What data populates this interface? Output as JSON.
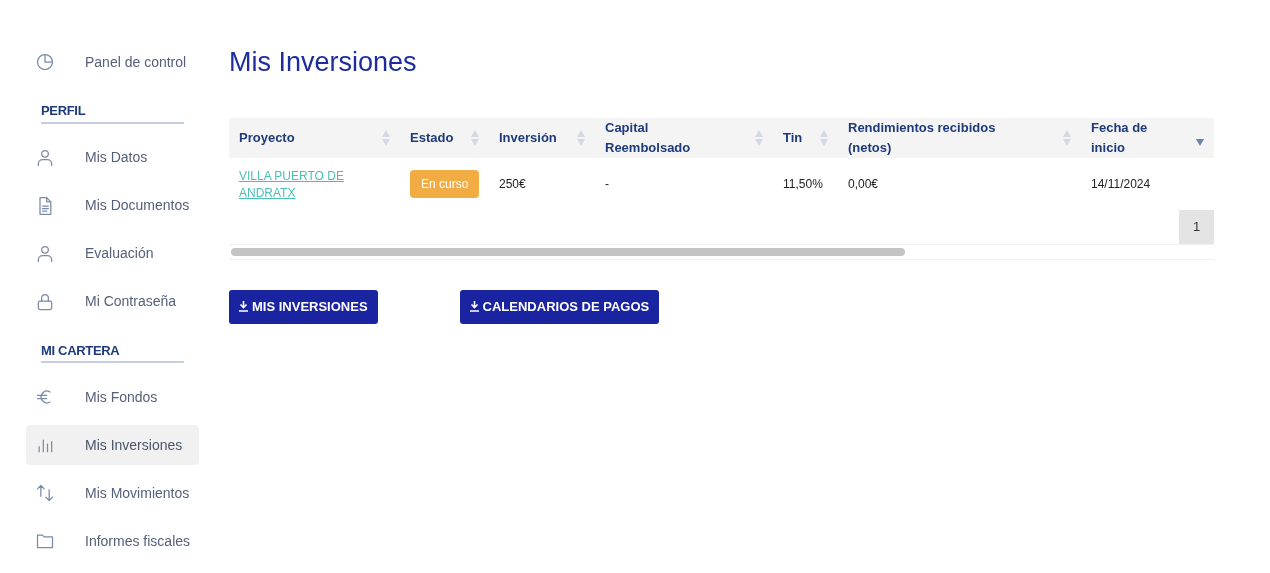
{
  "sidebar": {
    "items": [
      {
        "kind": "link",
        "label": "Panel de control",
        "selected": false
      },
      {
        "kind": "header",
        "label": "PERFIL"
      },
      {
        "kind": "link",
        "label": "Mis Datos",
        "selected": false
      },
      {
        "kind": "link",
        "label": "Mis Documentos",
        "selected": false
      },
      {
        "kind": "link",
        "label": "Evaluación",
        "selected": false
      },
      {
        "kind": "link",
        "label": "Mi Contraseña",
        "selected": false
      },
      {
        "kind": "header",
        "label": "MI CARTERA"
      },
      {
        "kind": "link",
        "label": "Mis Fondos",
        "selected": false
      },
      {
        "kind": "link",
        "label": "Mis Inversiones",
        "selected": true
      },
      {
        "kind": "link",
        "label": "Mis Movimientos",
        "selected": false
      },
      {
        "kind": "link",
        "label": "Informes fiscales",
        "selected": false
      }
    ]
  },
  "page_title": "Mis Inversiones",
  "table": {
    "columns": [
      {
        "label": "Proyecto",
        "sorted": false
      },
      {
        "label": "Estado",
        "sorted": false
      },
      {
        "label": "Inversión",
        "sorted": false
      },
      {
        "label": "Capital Reembolsado",
        "sorted": false
      },
      {
        "label": "Tin",
        "sorted": false
      },
      {
        "label": "Rendimientos recibidos (netos)",
        "sorted": false
      },
      {
        "label": "Fecha de inicio",
        "sorted": true
      }
    ],
    "rows": [
      {
        "cells": [
          {
            "kind": "link",
            "text": "VILLA PUERTO DE ANDRATX"
          },
          {
            "kind": "badge",
            "text": "En curso",
            "color": "#f2ac44"
          },
          {
            "kind": "text",
            "text": "250€"
          },
          {
            "kind": "text",
            "text": "-"
          },
          {
            "kind": "text",
            "text": "11,50%"
          },
          {
            "kind": "text",
            "text": "0,00€"
          },
          {
            "kind": "text",
            "text": "14/11/2024"
          }
        ]
      }
    ],
    "pages": [
      {
        "label": "1",
        "selected": true
      }
    ]
  },
  "buttons": [
    "MIS INVERSIONES",
    "CALENDARIOS DE PAGOS"
  ]
}
